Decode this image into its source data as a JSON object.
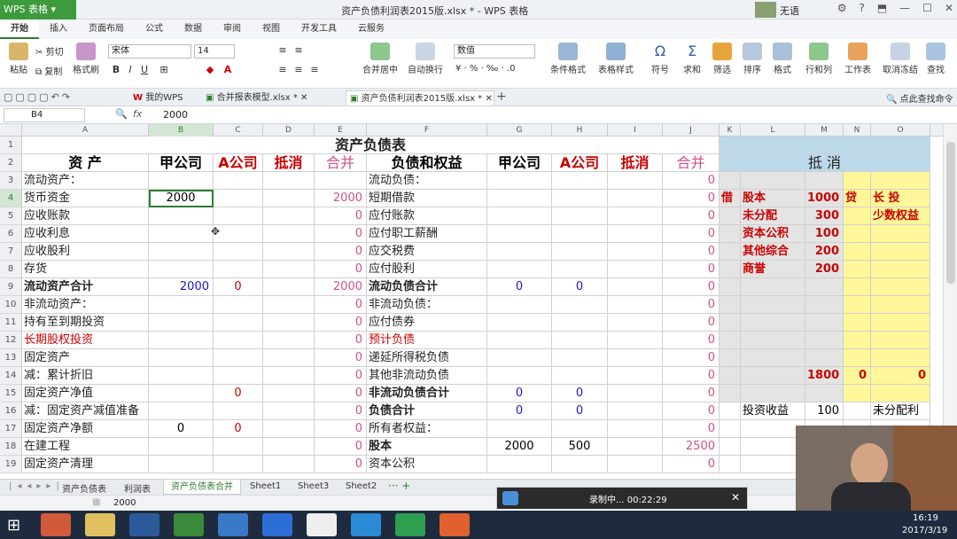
{
  "app": {
    "name": "WPS 表格",
    "title": "资产负债利润表2015版.xlsx * - WPS 表格",
    "user": "无语"
  },
  "ribbon_tabs": [
    "开始",
    "插入",
    "页面布局",
    "公式",
    "数据",
    "审阅",
    "视图",
    "开发工具",
    "云服务"
  ],
  "ribbon": {
    "paste": "粘贴",
    "cut": "剪切",
    "copy": "复制",
    "format_painter": "格式刷",
    "font": "宋体",
    "size": "14",
    "merge": "合并居中",
    "wrap": "自动换行",
    "numfmt": "数值",
    "cond": "条件格式",
    "tblstyle": "表格样式",
    "symbol": "符号",
    "sum": "求和",
    "filter": "筛选",
    "sort": "排序",
    "format": "格式",
    "rowcol": "行和列",
    "sheet": "工作表",
    "freeze": "取消冻结",
    "find": "查找"
  },
  "doc_tabs": [
    "我的WPS",
    "合并报表模型.xlsx *",
    "资产负债利润表2015版.xlsx *"
  ],
  "find_cmd": "点此查找命令",
  "formula": {
    "ref": "B4",
    "fx": "fx",
    "value": "2000"
  },
  "columns": [
    "A",
    "B",
    "C",
    "D",
    "E",
    "F",
    "G",
    "H",
    "I",
    "J",
    "K",
    "L",
    "M",
    "N",
    "O"
  ],
  "rows": [
    {
      "n": "1"
    },
    {
      "n": "2"
    },
    {
      "n": "3"
    },
    {
      "n": "4"
    },
    {
      "n": "5"
    },
    {
      "n": "6"
    },
    {
      "n": "7"
    },
    {
      "n": "8"
    },
    {
      "n": "9"
    },
    {
      "n": "10"
    },
    {
      "n": "11"
    },
    {
      "n": "12"
    },
    {
      "n": "13"
    },
    {
      "n": "14"
    },
    {
      "n": "15"
    },
    {
      "n": "16"
    },
    {
      "n": "17"
    },
    {
      "n": "18"
    },
    {
      "n": "19"
    }
  ],
  "sheet": {
    "title": "资产负债表",
    "headers": {
      "A": "资  产",
      "B": "甲公司",
      "C": "A公司",
      "D": "抵消",
      "E": "合并",
      "F": "负债和权益",
      "G": "甲公司",
      "H": "A公司",
      "I": "抵消",
      "J": "合并",
      "KO": "抵  消"
    },
    "A": [
      "流动资产：",
      "货币资金",
      "应收账款",
      "应收利息",
      "应收股利",
      "存货",
      "流动资产合计",
      "非流动资产：",
      "持有至到期投资",
      "长期股权投资",
      "固定资产",
      "  减：累计折旧",
      "固定资产净值",
      "减：固定资产减值准备",
      "固定资产净额",
      "在建工程",
      "固定资产清理"
    ],
    "B": {
      "4": "2000",
      "9": "2000",
      "17": "0"
    },
    "C": {
      "9": "0",
      "15": "0",
      "17": "0"
    },
    "E": {
      "4": "2000",
      "5": "0",
      "6": "0",
      "7": "0",
      "8": "0",
      "9": "2000",
      "10": "0",
      "11": "0",
      "12": "0",
      "13": "0",
      "14": "0",
      "15": "0",
      "16": "0",
      "17": "0",
      "18": "0",
      "19": "0"
    },
    "F": [
      "流动负债：",
      "短期借款",
      "应付账款",
      "应付职工薪酬",
      "应交税费",
      "应付股利",
      "流动负债合计",
      "非流动负债：",
      "应付债券",
      "预计负债",
      "递延所得税负债",
      "其他非流动负债",
      "非流动负债合计",
      "负债合计",
      "所有者权益：",
      "股本",
      "资本公积"
    ],
    "G": {
      "9": "0",
      "15": "0",
      "16": "0",
      "18": "2000"
    },
    "H": {
      "9": "0",
      "15": "0",
      "16": "0",
      "18": "500"
    },
    "J": {
      "3": "0",
      "4": "0",
      "5": "0",
      "6": "0",
      "7": "0",
      "8": "0",
      "9": "0",
      "10": "0",
      "11": "0",
      "12": "0",
      "13": "0",
      "14": "0",
      "15": "0",
      "16": "0",
      "17": "0",
      "18": "2500",
      "19": "0"
    },
    "K": {
      "4": "借"
    },
    "L": {
      "4": "股本",
      "5": "未分配",
      "6": "资本公积",
      "7": "其他综合",
      "8": "商誉",
      "16": "投资收益"
    },
    "M": {
      "4": "1000",
      "5": "300",
      "6": "100",
      "7": "200",
      "8": "200",
      "14": "1800",
      "16": "100"
    },
    "N": {
      "4": "贷",
      "14": "0"
    },
    "O": {
      "4": "长 投",
      "5": "少数权益",
      "14": "0",
      "16": "未分配利"
    }
  },
  "sheet_tabs": [
    "资产负债表",
    "利润表",
    "资产负债表合并",
    "Sheet1",
    "Sheet3",
    "Sheet2"
  ],
  "status_value": "2000",
  "recording": {
    "text": "录制中... 00:22:29"
  },
  "clock": {
    "time": "16:19",
    "date": "2017/3/19"
  },
  "colors": {
    "green": "#2e7d32",
    "red": "#cc0000",
    "blue": "#1a1acc",
    "pink": "#d0508c",
    "header_blue": "#bcd9ea",
    "yellow": "#fff799"
  }
}
